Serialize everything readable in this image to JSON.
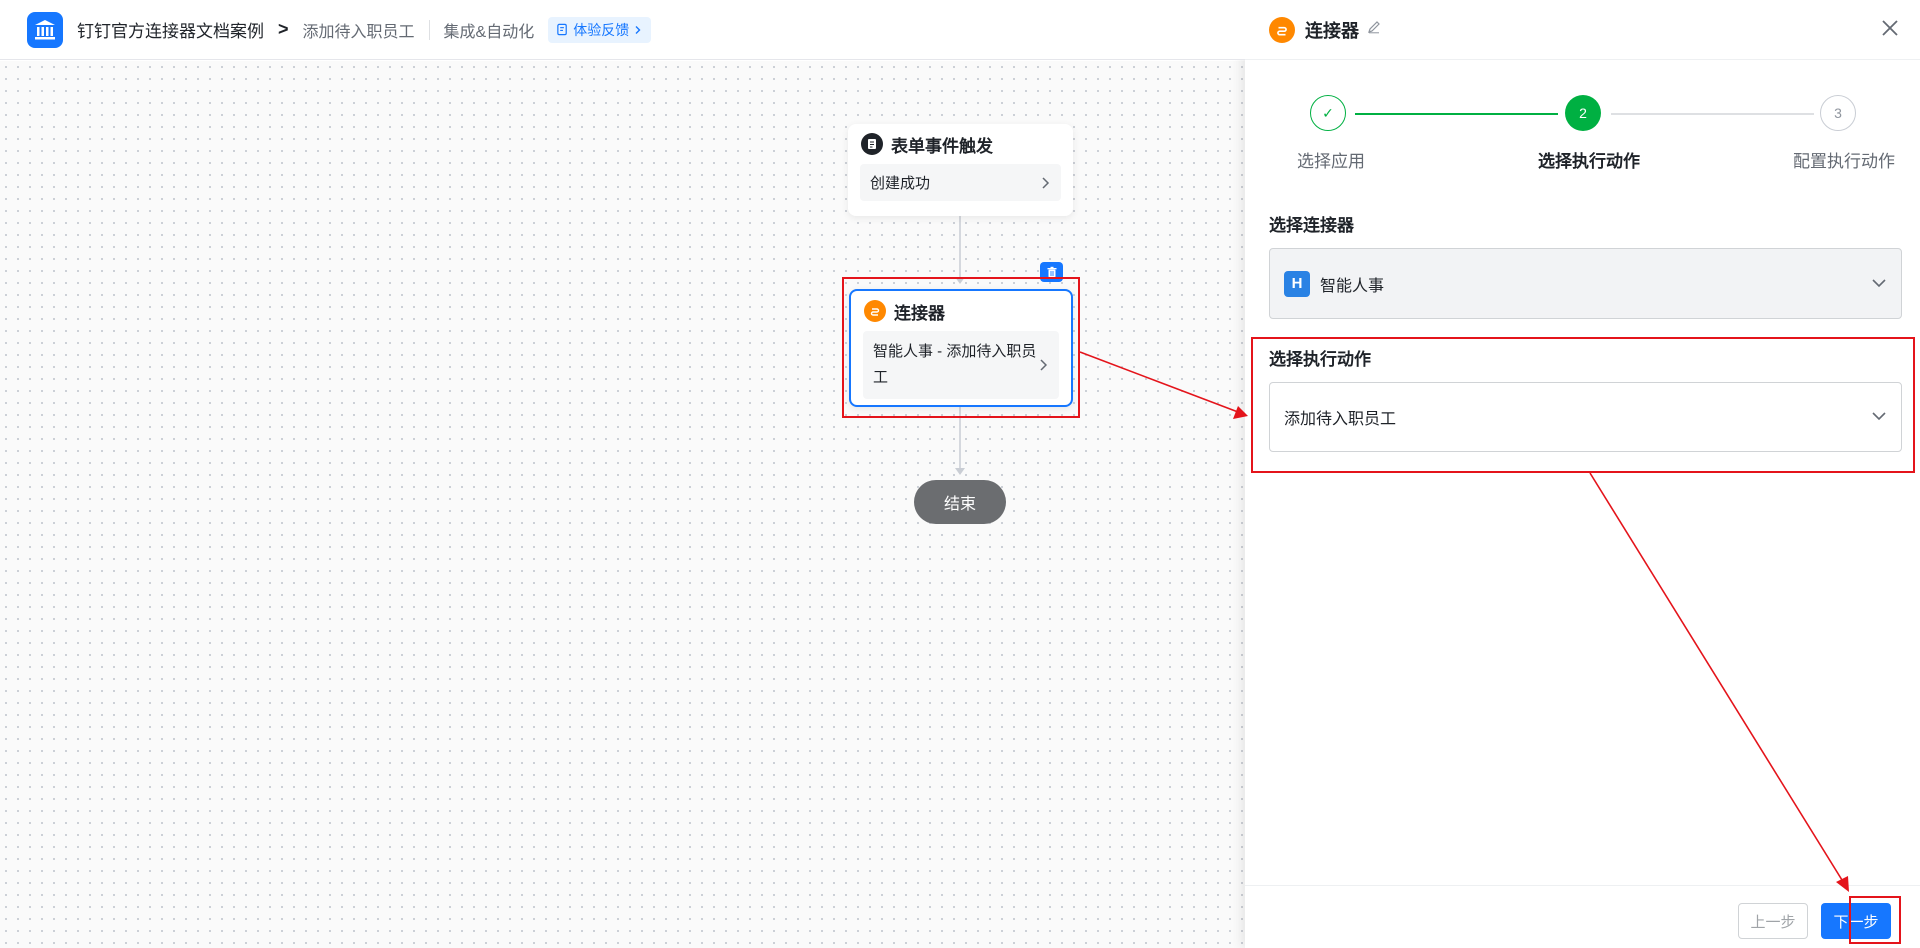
{
  "header": {
    "app_title": "钉钉官方连接器文档案例",
    "breadcrumb_arrow": ">",
    "page_name": "添加待入职员工",
    "nav_link": "集成&自动化",
    "feedback_label": "体验反馈"
  },
  "canvas": {
    "trigger_node": {
      "title": "表单事件触发",
      "body": "创建成功"
    },
    "connector_node": {
      "title": "连接器",
      "body": "智能人事 - 添加待入职员工"
    },
    "end_node": {
      "label": "结束"
    }
  },
  "panel": {
    "title": "连接器",
    "steps": [
      {
        "number": "✓",
        "label": "选择应用",
        "state": "done"
      },
      {
        "number": "2",
        "label": "选择执行动作",
        "state": "active"
      },
      {
        "number": "3",
        "label": "配置执行动作",
        "state": "pending"
      }
    ],
    "connector_field": {
      "label": "选择连接器",
      "value": "智能人事",
      "logo_letter": "H"
    },
    "action_field": {
      "label": "选择执行动作",
      "value": "添加待入职员工"
    },
    "buttons": {
      "prev": "上一步",
      "next": "下一步"
    }
  },
  "colors": {
    "primary": "#1677ff",
    "success": "#00b042",
    "connector_orange": "#ff8800",
    "highlight_red": "#e4141b"
  }
}
